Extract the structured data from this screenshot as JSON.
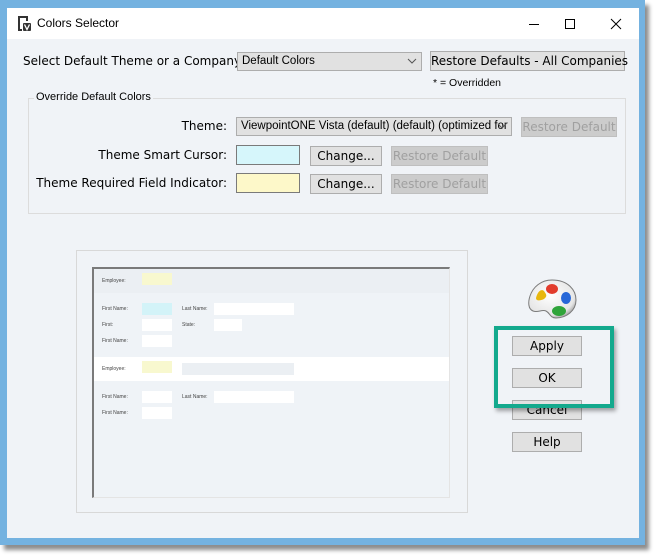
{
  "window": {
    "title": "Colors Selector",
    "icons": {
      "app": "viewpoint-v-icon",
      "minimize": "minimize-icon",
      "maximize": "maximize-icon",
      "close": "close-icon"
    }
  },
  "top": {
    "company_label": "Select Default Theme or a Company:",
    "company_value": "Default Colors",
    "restore_all_label": "Restore Defaults - All Companies",
    "overridden_note": "* = Overridden"
  },
  "override": {
    "group_title": "Override Default Colors",
    "theme_label": "Theme:",
    "theme_value": "ViewpointONE Vista (default) (default) (optimized for",
    "theme_restore_label": "Restore Default",
    "rows": [
      {
        "label": "Theme Smart Cursor:",
        "color": "#d6f6fb",
        "change_label": "Change...",
        "restore_label": "Restore Default"
      },
      {
        "label": "Theme Required Field Indicator:",
        "color": "#fdf8c9",
        "change_label": "Change...",
        "restore_label": "Restore Default"
      }
    ]
  },
  "preview": {
    "section1": {
      "header_label": "Employee:",
      "required_color": "#f8f8cf",
      "fields": [
        {
          "label": "First Name:",
          "smart_cursor": true
        },
        {
          "label": "Last Name:"
        },
        {
          "label": "First:"
        },
        {
          "label": "State:"
        },
        {
          "label": "First Name:"
        }
      ]
    },
    "section2": {
      "header_label": "Employee:",
      "fields": [
        {
          "label": "First Name:"
        },
        {
          "label": "Last Name:"
        },
        {
          "label": "First Name:"
        }
      ]
    },
    "smart_cursor_color": "#d3f3f8"
  },
  "actions": {
    "apply_label": "Apply",
    "ok_label": "OK",
    "cancel_label": "Cancel",
    "help_label": "Help",
    "palette_icon": "paint-palette-icon",
    "highlight_color": "#13a98d"
  }
}
